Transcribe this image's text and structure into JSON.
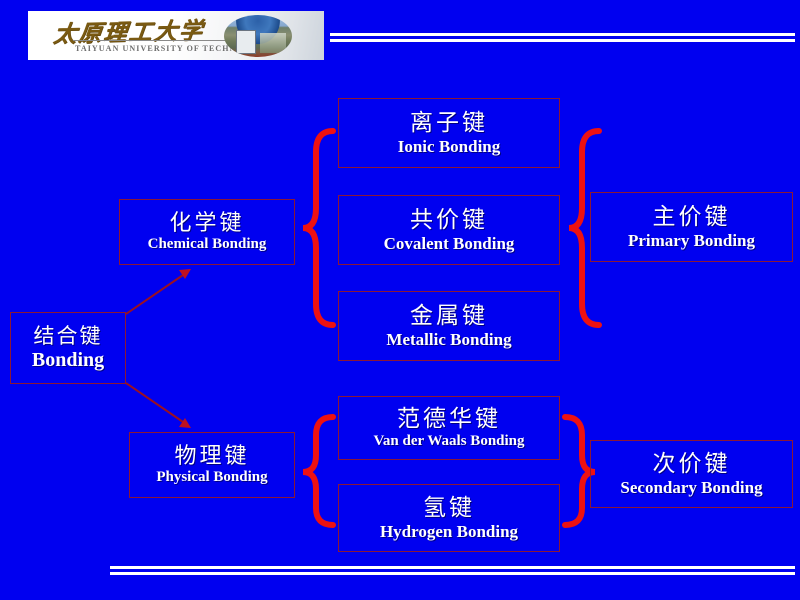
{
  "slide": {
    "background_color": "#0000f0",
    "box_border_color": "#8c1834",
    "brace_color": "#ee1111",
    "arrow_color": "#9b1020",
    "rule_color": "#ffffff"
  },
  "header": {
    "logo": {
      "university_cn": "太原理工大学",
      "university_en": "TAIYUAN UNIVERSITY OF TECHNOLOGY",
      "photo_alt": "campus-photo"
    }
  },
  "diagram": {
    "root": {
      "cn": "结合键",
      "en": "Bonding"
    },
    "branches": [
      {
        "cn": "化学键",
        "en": "Chemical Bonding"
      },
      {
        "cn": "物理键",
        "en": "Physical Bonding"
      }
    ],
    "types": [
      {
        "cn": "离子键",
        "en": "Ionic Bonding"
      },
      {
        "cn": "共价键",
        "en": "Covalent Bonding"
      },
      {
        "cn": "金属键",
        "en": "Metallic Bonding"
      },
      {
        "cn": "范德华键",
        "en": "Van der Waals Bonding"
      },
      {
        "cn": "氢键",
        "en": "Hydrogen Bonding"
      }
    ],
    "groups": [
      {
        "cn": "主价键",
        "en": "Primary Bonding"
      },
      {
        "cn": "次价键",
        "en": "Secondary Bonding"
      }
    ]
  }
}
